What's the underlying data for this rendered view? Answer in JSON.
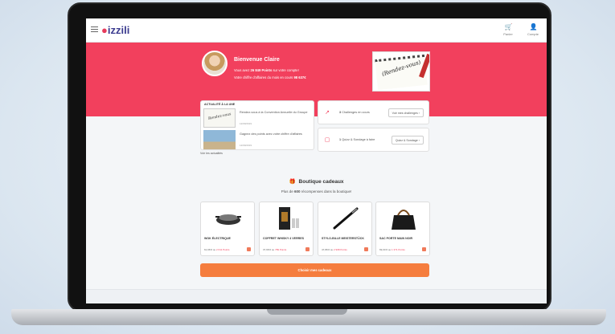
{
  "header": {
    "logo": "izzili",
    "actions": [
      {
        "label": "Panier",
        "icon": "cart-icon"
      },
      {
        "label": "Compte",
        "icon": "user-icon"
      }
    ]
  },
  "hero": {
    "title": "Bienvenue Claire",
    "points_prefix": "Vous avez",
    "points_value": "26 849 Points",
    "points_suffix": "sur votre compte!",
    "revenue_prefix": "Votre chiffre d'affaires du mois en cours",
    "revenue_value": "98 637€",
    "image_text": "(Rendez-vous)"
  },
  "news": {
    "title": "ACTUALITÉ À LA UNE",
    "items": [
      {
        "text": "Rendez-vous à la Convention Annuelle du Groupe",
        "date": "12/09/2019",
        "thumb_text": "Rendez-vous"
      },
      {
        "text": "Gagnez des points avec votre chiffre d'affaires",
        "date": "12/09/2019",
        "thumb_text": ""
      }
    ],
    "see_all": "Voir les actualités"
  },
  "stats": [
    {
      "count": "3",
      "label": "Challenges en cours",
      "button": "Voir mes challenges",
      "icon": "trend-icon"
    },
    {
      "count": "1",
      "label": "Quizz & Sondage à faire",
      "button": "Quizz & Sondage",
      "icon": "chat-icon"
    }
  ],
  "boutique": {
    "title": "Boutique cadeaux",
    "subtitle_prefix": "Plus de",
    "subtitle_count": "600",
    "subtitle_suffix": "récompenses dans la boutique!",
    "products": [
      {
        "name": "WOK ÉLECTRIQUE",
        "price": "61,98 €",
        "points": "2 611 Points"
      },
      {
        "name": "COFFRET WHISKY 4 VERRES",
        "price": "37,68 €",
        "points": "789 Points"
      },
      {
        "name": "STYLO-BILLE MEISTERSTÜCK",
        "price": "47,88 €",
        "points": "2 968 Points"
      },
      {
        "name": "SAC PORTE MAIN NOIR",
        "price": "69,00 €",
        "points": "1 371 Points"
      }
    ],
    "cta": "Choisir mes cadeaux"
  },
  "colors": {
    "brand": "#f2405d",
    "cta": "#f57d3e"
  }
}
